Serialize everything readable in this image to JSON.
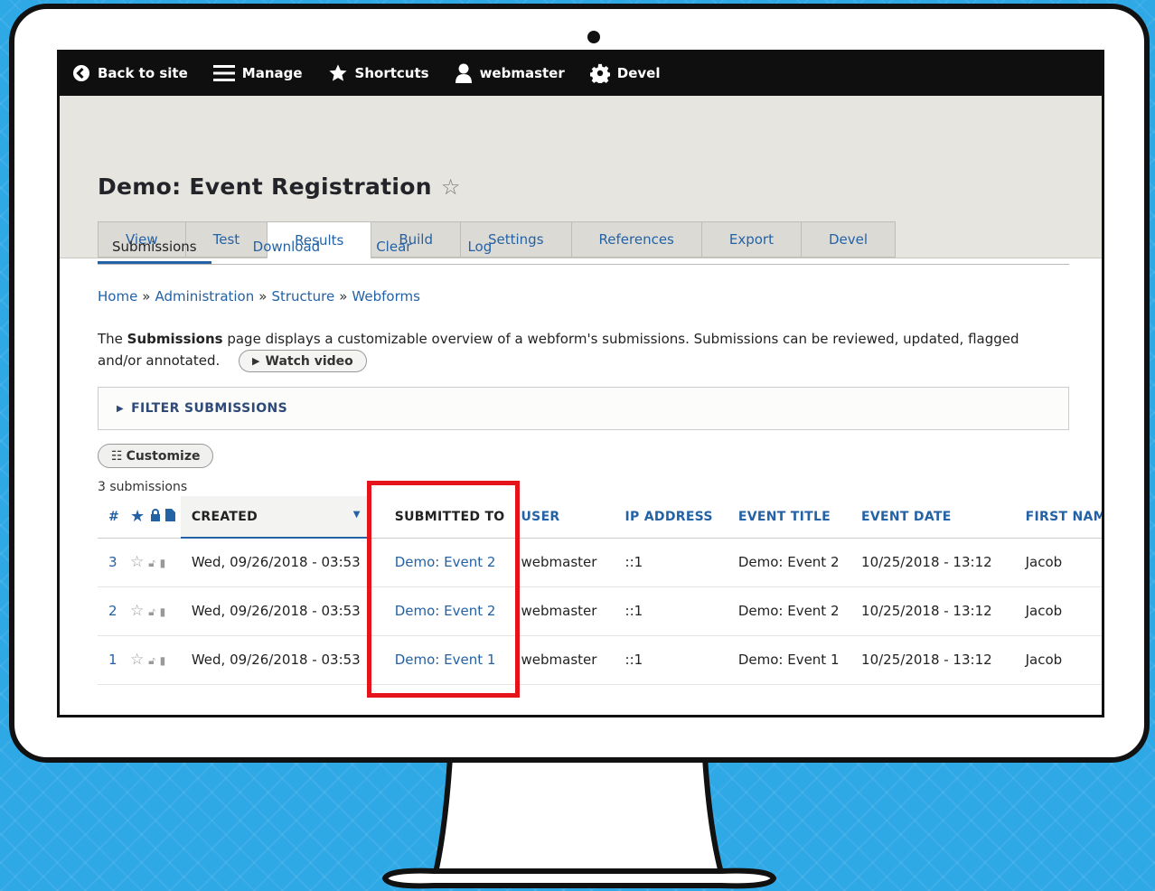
{
  "toolbar": {
    "back": "Back to site",
    "manage": "Manage",
    "shortcuts": "Shortcuts",
    "user": "webmaster",
    "devel": "Devel"
  },
  "page": {
    "title": "Demo: Event Registration"
  },
  "tabs": [
    "View",
    "Test",
    "Results",
    "Build",
    "Settings",
    "References",
    "Export",
    "Devel"
  ],
  "subtabs": [
    "Submissions",
    "Download",
    "Clear",
    "Log"
  ],
  "breadcrumb": [
    "Home",
    "Administration",
    "Structure",
    "Webforms"
  ],
  "description": {
    "prefix": "The ",
    "bold": "Submissions",
    "suffix": " page displays a customizable overview of a webform's submissions. Submissions can be reviewed, updated, flagged and/or annotated.",
    "watch_video": "Watch video"
  },
  "filter": {
    "label": "FILTER SUBMISSIONS"
  },
  "customize": {
    "label": "Customize"
  },
  "count": "3 submissions",
  "table": {
    "headers": {
      "num": "#",
      "created": "CREATED",
      "submitted_to": "SUBMITTED TO",
      "user": "USER",
      "ip": "IP ADDRESS",
      "event_title": "EVENT TITLE",
      "event_date": "EVENT DATE",
      "first_name": "FIRST NAME"
    },
    "rows": [
      {
        "num": "3",
        "created": "Wed, 09/26/2018 - 03:53",
        "submitted_to": "Demo: Event 2",
        "user": "webmaster",
        "ip": "::1",
        "event_title": "Demo: Event 2",
        "event_date": "10/25/2018 - 13:12",
        "first_name": "Jacob"
      },
      {
        "num": "2",
        "created": "Wed, 09/26/2018 - 03:53",
        "submitted_to": "Demo: Event 2",
        "user": "webmaster",
        "ip": "::1",
        "event_title": "Demo: Event 2",
        "event_date": "10/25/2018 - 13:12",
        "first_name": "Jacob"
      },
      {
        "num": "1",
        "created": "Wed, 09/26/2018 - 03:53",
        "submitted_to": "Demo: Event 1",
        "user": "webmaster",
        "ip": "::1",
        "event_title": "Demo: Event 1",
        "event_date": "10/25/2018 - 13:12",
        "first_name": "Jacob"
      }
    ]
  },
  "colors": {
    "link": "#2462a6",
    "toolbar_bg": "#0f0f0f",
    "header_bg": "#e7e5e0",
    "highlight": "#e5131a",
    "background": "#2fa8e6"
  }
}
